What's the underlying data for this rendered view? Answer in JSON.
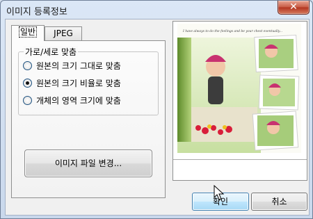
{
  "window": {
    "title": "이미지 등록정보",
    "close_glyph": "✕"
  },
  "tabs": [
    {
      "label": "일반",
      "active": true
    },
    {
      "label": "JPEG",
      "active": false
    }
  ],
  "group": {
    "legend": "가로/세로 맞춤",
    "options": [
      {
        "label": "원본의 크기 그대로 맞춤",
        "checked": false
      },
      {
        "label": "원본의 크기 비율로 맞춤",
        "checked": true
      },
      {
        "label": "개체의 영역 크기에 맞춤",
        "checked": false
      }
    ]
  },
  "change_image_label": "이미지 파일 변경...",
  "preview": {
    "caption": "I have always to do the feelings and be your chest eventually..."
  },
  "buttons": {
    "ok": "확인",
    "cancel": "취소"
  },
  "colors": {
    "accent": "#3c7fb1",
    "close": "#c75a43"
  }
}
